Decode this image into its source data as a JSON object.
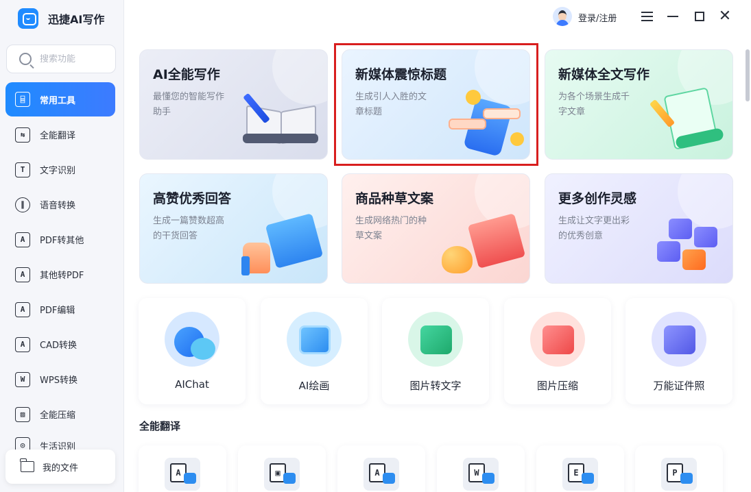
{
  "app": {
    "name": "迅捷AI写作"
  },
  "search": {
    "placeholder": "搜索功能"
  },
  "sidebar": {
    "items": [
      {
        "label": "常用工具",
        "icon": "toolbox-icon",
        "active": true
      },
      {
        "label": "全能翻译",
        "icon": "translate-icon"
      },
      {
        "label": "文字识别",
        "icon": "text-recognition-icon"
      },
      {
        "label": "语音转换",
        "icon": "voice-icon"
      },
      {
        "label": "PDF转其他",
        "icon": "pdf-convert-icon"
      },
      {
        "label": "其他转PDF",
        "icon": "to-pdf-icon"
      },
      {
        "label": "PDF编辑",
        "icon": "pdf-edit-icon"
      },
      {
        "label": "CAD转换",
        "icon": "cad-icon"
      },
      {
        "label": "WPS转换",
        "icon": "wps-icon"
      },
      {
        "label": "全能压缩",
        "icon": "compress-icon"
      },
      {
        "label": "生活识别",
        "icon": "life-recognition-icon"
      }
    ],
    "my_files": "我的文件"
  },
  "titlebar": {
    "login": "登录/注册"
  },
  "cards": [
    {
      "title": "AI全能写作",
      "desc": "最懂您的智能写作助手"
    },
    {
      "title": "新媒体震惊标题",
      "desc": "生成引人入胜的文章标题"
    },
    {
      "title": "新媒体全文写作",
      "desc": "为各个场景生成千字文章"
    },
    {
      "title": "高赞优秀回答",
      "desc": "生成一篇赞数超高的干货回答"
    },
    {
      "title": "商品种草文案",
      "desc": "生成网络热门的种草文案"
    },
    {
      "title": "更多创作灵感",
      "desc": "生成让文字更出彩的优秀创意"
    }
  ],
  "tools": [
    {
      "label": "AIChat",
      "icon": "chat-icon"
    },
    {
      "label": "AI绘画",
      "icon": "painting-icon"
    },
    {
      "label": "图片转文字",
      "icon": "image-to-text-icon"
    },
    {
      "label": "图片压缩",
      "icon": "image-compress-icon"
    },
    {
      "label": "万能证件照",
      "icon": "id-photo-icon"
    }
  ],
  "translate_section": {
    "title": "全能翻译",
    "items": [
      {
        "icon": "doc-translate-icon",
        "glyph": "A"
      },
      {
        "icon": "image-translate-icon",
        "glyph": "▣"
      },
      {
        "icon": "pdf-translate-icon",
        "glyph": "A"
      },
      {
        "icon": "word-translate-icon",
        "glyph": "W"
      },
      {
        "icon": "excel-translate-icon",
        "glyph": "E"
      },
      {
        "icon": "ppt-translate-icon",
        "glyph": "P"
      }
    ]
  },
  "colors": {
    "accent": "#1f8bff",
    "highlight_border": "#d81e1e",
    "sidebar_bg": "#f5f6fa"
  }
}
